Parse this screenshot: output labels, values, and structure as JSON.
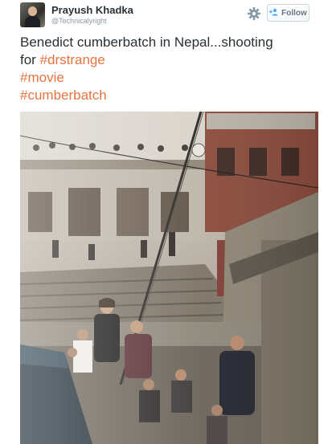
{
  "user": {
    "display_name": "Prayush Khadka",
    "handle": "@Technicalyright"
  },
  "follow_button": {
    "label": "Follow",
    "icon": "add-user-icon"
  },
  "gear_icon": "gear-icon",
  "tweet": {
    "text_line1": "Benedict cumberbatch in Nepal...shooting",
    "text_line2_prefix": "for ",
    "hashtags": [
      "#drstrange",
      "#movie",
      "#cumberbatch"
    ]
  },
  "colors": {
    "hashtag": "#e8733f",
    "name": "#292f33",
    "muted": "#8899a6"
  }
}
